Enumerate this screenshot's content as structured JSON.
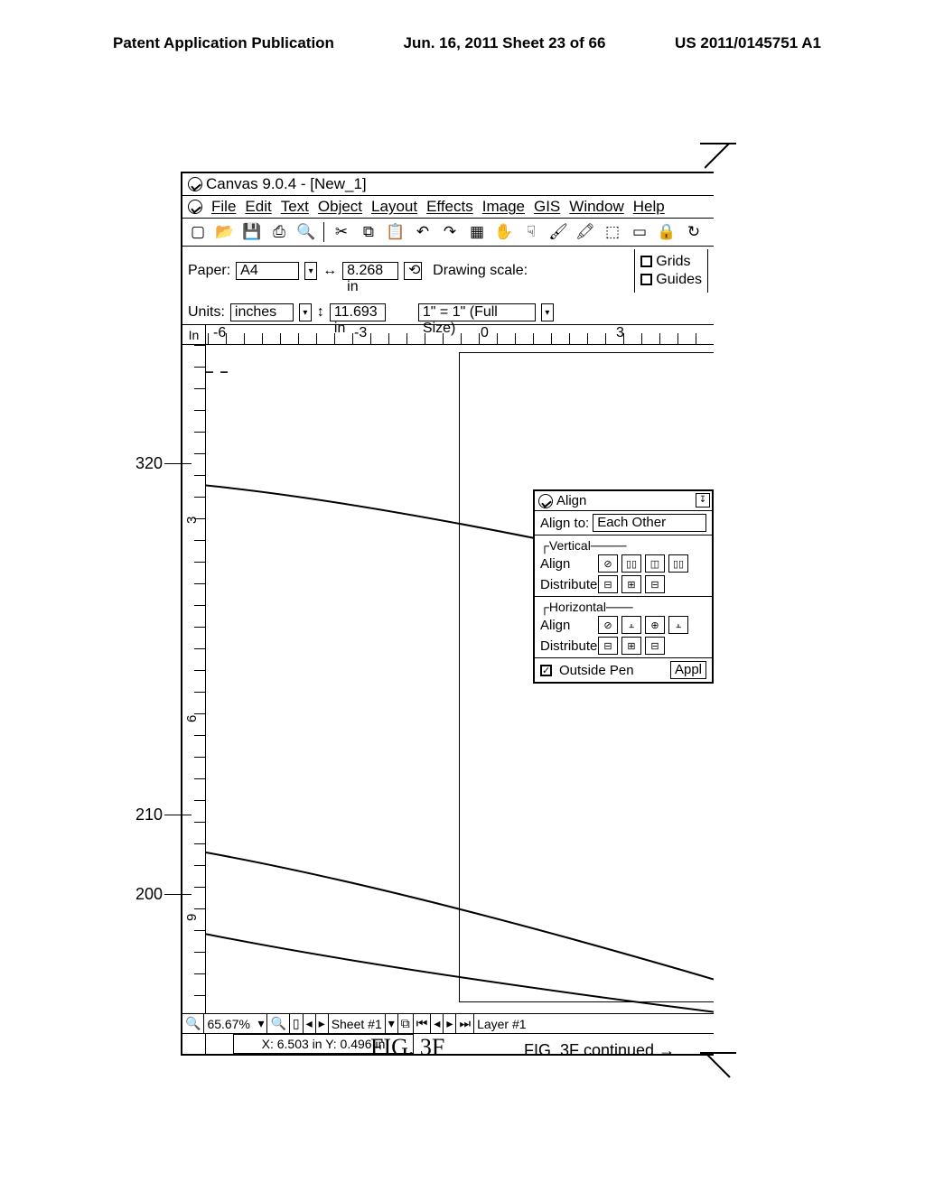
{
  "header": {
    "left": "Patent Application Publication",
    "mid": "Jun. 16, 2011  Sheet 23 of 66",
    "right": "US 2011/0145751 A1"
  },
  "title": "Canvas 9.0.4 - [New_1]",
  "menu": {
    "file": "File",
    "edit": "Edit",
    "text": "Text",
    "object": "Object",
    "layout": "Layout",
    "effects": "Effects",
    "image": "Image",
    "gis": "GIS",
    "window": "Window",
    "help": "Help"
  },
  "prop": {
    "paper_label": "Paper:",
    "paper_value": "A4",
    "units_label": "Units:",
    "units_value": "inches",
    "width": "8.268 in",
    "height": "11.693 in",
    "scale_label": "Drawing scale:",
    "scale_value": "1\" = 1\" (Full Size)",
    "grids": "Grids",
    "guides": "Guides"
  },
  "ruler": {
    "corner": "In",
    "h": [
      "-6",
      "-3",
      "0",
      "3"
    ],
    "v": [
      "3",
      "6",
      "9"
    ]
  },
  "align": {
    "title": "Align",
    "to_label": "Align to:",
    "to_value": "Each Other",
    "vertical": "Vertical",
    "horizontal": "Horizontal",
    "align": "Align",
    "distribute": "Distribute",
    "outside_pen": "Outside Pen",
    "apply": "Appl"
  },
  "status": {
    "zoom": "65.67%",
    "sheet": "Sheet #1",
    "layer": "Layer #1",
    "coords": "X: 6.503 in  Y: 0.496 in"
  },
  "figure": {
    "label": "FIG. 3F",
    "continued": "FIG. 3F continued"
  },
  "callouts": {
    "c320": "320",
    "c210": "210",
    "c200": "200"
  }
}
